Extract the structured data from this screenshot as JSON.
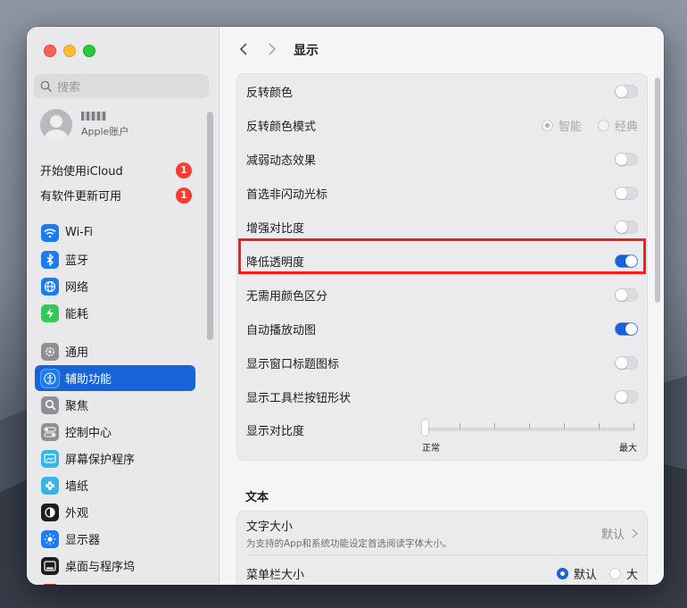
{
  "window_title": "显示",
  "search": {
    "placeholder": "搜索"
  },
  "user": {
    "subtitle": "Apple账户"
  },
  "notices": [
    {
      "label": "开始使用iCloud",
      "badge": "1"
    },
    {
      "label": "有软件更新可用",
      "badge": "1"
    }
  ],
  "sidebar": {
    "items": [
      {
        "label": "Wi-Fi"
      },
      {
        "label": "蓝牙"
      },
      {
        "label": "网络"
      },
      {
        "label": "能耗"
      },
      {
        "label": "通用"
      },
      {
        "label": "辅助功能"
      },
      {
        "label": "聚焦"
      },
      {
        "label": "控制中心"
      },
      {
        "label": "屏幕保护程序"
      },
      {
        "label": "墙纸"
      },
      {
        "label": "外观"
      },
      {
        "label": "显示器"
      },
      {
        "label": "桌面与程序坞"
      }
    ]
  },
  "display": {
    "rows": [
      {
        "label": "反转颜色",
        "on": false
      },
      {
        "label": "反转颜色模式",
        "option_a": "智能",
        "option_b": "经典"
      },
      {
        "label": "减弱动态效果",
        "on": false
      },
      {
        "label": "首选非闪动光标",
        "on": false
      },
      {
        "label": "增强对比度",
        "on": false
      },
      {
        "label": "降低透明度",
        "on": true
      },
      {
        "label": "无需用颜色区分",
        "on": false
      },
      {
        "label": "自动播放动图",
        "on": true
      },
      {
        "label": "显示窗口标题图标",
        "on": false
      },
      {
        "label": "显示工具栏按钮形状",
        "on": false
      },
      {
        "label": "显示对比度",
        "slider_min": "正常",
        "slider_max": "最大",
        "slider_value": 0
      }
    ]
  },
  "text_section": {
    "title": "文本",
    "text_size": {
      "label": "文字大小",
      "description": "为支持的App和系统功能设定首选阅读字体大小。",
      "value": "默认"
    },
    "menubar_size": {
      "label": "菜单栏大小",
      "option_a": "默认",
      "option_b": "大"
    }
  },
  "colors": {
    "accent": "#1763d8",
    "highlight": "#ff1a1a"
  }
}
